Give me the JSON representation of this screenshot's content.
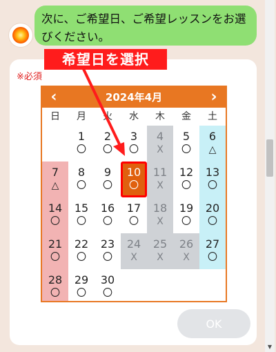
{
  "chat": {
    "message": "次に、ご希望日、ご希望レッスンをお選びください。"
  },
  "form": {
    "required_label": "※必須",
    "ok_label": "OK"
  },
  "calendar": {
    "title": "2024年4月",
    "prev_icon": "‹",
    "next_icon": "›",
    "weekdays": [
      "日",
      "月",
      "火",
      "水",
      "木",
      "金",
      "土"
    ],
    "selected_day": 10,
    "days": [
      {
        "day": "1",
        "mark": "〇",
        "col": 1,
        "row": 0,
        "kind": "normal"
      },
      {
        "day": "2",
        "mark": "〇",
        "col": 2,
        "row": 0,
        "kind": "normal"
      },
      {
        "day": "3",
        "mark": "〇",
        "col": 3,
        "row": 0,
        "kind": "normal"
      },
      {
        "day": "4",
        "mark": "X",
        "col": 4,
        "row": 0,
        "kind": "closed"
      },
      {
        "day": "5",
        "mark": "〇",
        "col": 5,
        "row": 0,
        "kind": "normal"
      },
      {
        "day": "6",
        "mark": "△",
        "col": 6,
        "row": 0,
        "kind": "sat"
      },
      {
        "day": "7",
        "mark": "△",
        "col": 0,
        "row": 1,
        "kind": "sun"
      },
      {
        "day": "8",
        "mark": "〇",
        "col": 1,
        "row": 1,
        "kind": "normal"
      },
      {
        "day": "9",
        "mark": "〇",
        "col": 2,
        "row": 1,
        "kind": "normal"
      },
      {
        "day": "10",
        "mark": "〇",
        "col": 3,
        "row": 1,
        "kind": "selected"
      },
      {
        "day": "11",
        "mark": "X",
        "col": 4,
        "row": 1,
        "kind": "closed"
      },
      {
        "day": "12",
        "mark": "〇",
        "col": 5,
        "row": 1,
        "kind": "normal"
      },
      {
        "day": "13",
        "mark": "〇",
        "col": 6,
        "row": 1,
        "kind": "sat"
      },
      {
        "day": "14",
        "mark": "〇",
        "col": 0,
        "row": 2,
        "kind": "sun"
      },
      {
        "day": "15",
        "mark": "〇",
        "col": 1,
        "row": 2,
        "kind": "normal"
      },
      {
        "day": "16",
        "mark": "〇",
        "col": 2,
        "row": 2,
        "kind": "normal"
      },
      {
        "day": "17",
        "mark": "〇",
        "col": 3,
        "row": 2,
        "kind": "normal"
      },
      {
        "day": "18",
        "mark": "X",
        "col": 4,
        "row": 2,
        "kind": "closed"
      },
      {
        "day": "19",
        "mark": "〇",
        "col": 5,
        "row": 2,
        "kind": "normal"
      },
      {
        "day": "20",
        "mark": "〇",
        "col": 6,
        "row": 2,
        "kind": "sat"
      },
      {
        "day": "21",
        "mark": "〇",
        "col": 0,
        "row": 3,
        "kind": "sun"
      },
      {
        "day": "22",
        "mark": "〇",
        "col": 1,
        "row": 3,
        "kind": "normal"
      },
      {
        "day": "23",
        "mark": "〇",
        "col": 2,
        "row": 3,
        "kind": "normal"
      },
      {
        "day": "24",
        "mark": "X",
        "col": 3,
        "row": 3,
        "kind": "closed"
      },
      {
        "day": "25",
        "mark": "X",
        "col": 4,
        "row": 3,
        "kind": "closed"
      },
      {
        "day": "26",
        "mark": "X",
        "col": 5,
        "row": 3,
        "kind": "closed"
      },
      {
        "day": "27",
        "mark": "〇",
        "col": 6,
        "row": 3,
        "kind": "sat"
      },
      {
        "day": "28",
        "mark": "〇",
        "col": 0,
        "row": 4,
        "kind": "sun"
      },
      {
        "day": "29",
        "mark": "〇",
        "col": 1,
        "row": 4,
        "kind": "normal"
      },
      {
        "day": "30",
        "mark": "〇",
        "col": 2,
        "row": 4,
        "kind": "normal"
      }
    ]
  },
  "annotation": {
    "callout": "希望日を選択"
  },
  "colors": {
    "calendar_accent": "#e87722",
    "selected_day": "#e0600e",
    "chat_bubble": "#8fdf73",
    "callout": "#ff1c1c"
  }
}
